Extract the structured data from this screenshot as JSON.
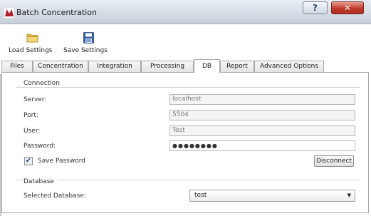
{
  "window": {
    "title": "Batch Concentration",
    "help_glyph": "?",
    "close_glyph": "✕",
    "app_icon": "app-logo-icon"
  },
  "toolbar": {
    "load": {
      "label": "Load Settings",
      "icon": "folder-icon"
    },
    "save": {
      "label": "Save Settings",
      "icon": "floppy-disk-icon"
    }
  },
  "tabs": [
    {
      "label": "Files",
      "active": false
    },
    {
      "label": "Concentration",
      "active": false
    },
    {
      "label": "Integration",
      "active": false
    },
    {
      "label": "Processing",
      "active": false
    },
    {
      "label": "DB",
      "active": true
    },
    {
      "label": "Report",
      "active": false
    },
    {
      "label": "Advanced Options",
      "active": false
    }
  ],
  "connection": {
    "title": "Connection",
    "server_label": "Server:",
    "server_value": "localhost",
    "port_label": "Port:",
    "port_value": "5504",
    "user_label": "User:",
    "user_value": "Test",
    "password_label": "Password:",
    "password_value": "●●●●●●●●",
    "save_password_label": "Save Password",
    "save_password_checked": true,
    "check_glyph": "✔",
    "disconnect_label": "Disconnect"
  },
  "database": {
    "title": "Database",
    "selected_label": "Selected Database:",
    "selected_value": "test",
    "arrow_glyph": "▼"
  }
}
